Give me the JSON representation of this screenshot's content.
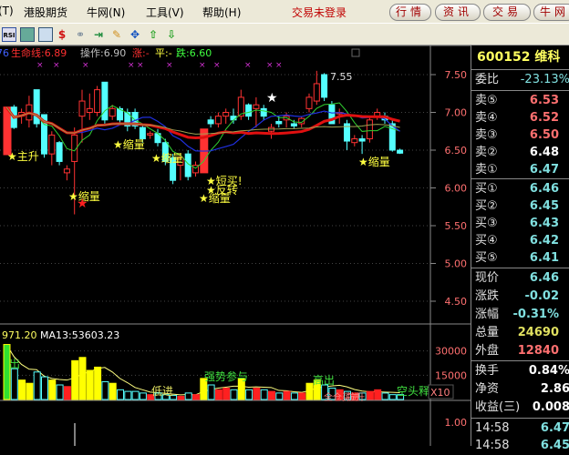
{
  "menu": {
    "items": [
      "(T)",
      "港股期货",
      "牛网(N)",
      "工具(V)",
      "帮助(H)"
    ],
    "login_status": "交易未登录",
    "buttons": [
      "行情",
      "资讯",
      "交易",
      "牛网"
    ]
  },
  "toolbar": {
    "icons": [
      "rsi-icon",
      "refresh-icon",
      "grid-icon",
      "dollar-icon",
      "connect-icon",
      "export-icon",
      "pencil-icon",
      "move-icon",
      "up-arrow-icon",
      "down-arrow-icon"
    ],
    "rsi_label": "RSI"
  },
  "indicator_header": {
    "prefix": "76",
    "life_line": "生命线:6.89",
    "operate": "操作:6.90",
    "rise": "涨:-",
    "flat": "平:-",
    "fall": "跌:6.60"
  },
  "price_axis": [
    "7.50",
    "7.00",
    "6.50",
    "6.00",
    "5.50",
    "5.00",
    "4.50"
  ],
  "annotations": {
    "high_label": "7.55",
    "signals": [
      "主升",
      "缩量",
      "缩量",
      "缩量",
      "短买!",
      "反转",
      "缩量",
      "缩量"
    ]
  },
  "volume_header": {
    "ma1": "971.20",
    "ma13": "MA13:53603.23"
  },
  "volume_axis": [
    "30000",
    "15000"
  ],
  "volume_labels": [
    "出",
    "强势参与",
    "低进",
    "高出",
    "空头释",
    "X10",
    "拉升",
    "全仓买进"
  ],
  "lower_axis": [
    "1.00"
  ],
  "quote": {
    "title": "600152 维科",
    "ratio_label": "委比",
    "ratio": "-23.13%",
    "asks": [
      {
        "label": "卖⑤",
        "price": "6.53"
      },
      {
        "label": "卖④",
        "price": "6.52"
      },
      {
        "label": "卖③",
        "price": "6.50"
      },
      {
        "label": "卖②",
        "price": "6.48"
      },
      {
        "label": "卖①",
        "price": "6.47"
      }
    ],
    "bids": [
      {
        "label": "买①",
        "price": "6.46"
      },
      {
        "label": "买②",
        "price": "6.45"
      },
      {
        "label": "买③",
        "price": "6.43"
      },
      {
        "label": "买④",
        "price": "6.42"
      },
      {
        "label": "买⑤",
        "price": "6.41"
      }
    ],
    "stats": [
      {
        "label": "现价",
        "value": "6.46"
      },
      {
        "label": "涨跌",
        "value": "-0.02"
      },
      {
        "label": "涨幅",
        "value": "-0.31%"
      },
      {
        "label": "总量",
        "value": "24690"
      },
      {
        "label": "外盘",
        "value": "12840"
      }
    ],
    "stats2": [
      {
        "label": "换手",
        "value": "0.84%"
      },
      {
        "label": "净资",
        "value": "2.86"
      },
      {
        "label": "收益(三)",
        "value": "0.008"
      }
    ],
    "ticks": [
      {
        "time": "14:58",
        "price": "6.47"
      },
      {
        "time": "14:58",
        "price": "6.45"
      }
    ]
  },
  "colors": {
    "up": "#ff3232",
    "down": "#54ffff",
    "ma_thick": "#e01010",
    "ma_blue": "#1020d0",
    "signal": "#ffff00"
  },
  "chart_data": {
    "type": "candlestick",
    "ylim": [
      4.4,
      7.7
    ],
    "ohlc": [
      [
        6.44,
        7.07,
        7.07,
        6.44,
        1
      ],
      [
        7.07,
        6.8,
        7.1,
        6.78
      ],
      [
        6.95,
        7.0,
        7.05,
        6.85
      ],
      [
        6.9,
        7.1,
        7.22,
        6.8
      ],
      [
        7.3,
        6.85,
        7.3,
        6.8
      ],
      [
        6.97,
        6.45,
        6.97,
        6.4
      ],
      [
        6.45,
        6.7,
        6.75,
        6.3
      ],
      [
        6.6,
        6.35,
        6.62,
        6.3
      ],
      [
        6.2,
        6.25,
        6.3,
        6.1
      ],
      [
        6.35,
        6.7,
        6.8,
        5.65
      ],
      [
        6.95,
        7.15,
        7.3,
        6.6
      ],
      [
        7.0,
        7.05,
        7.25,
        6.9
      ],
      [
        7.0,
        7.3,
        7.35,
        6.95
      ],
      [
        7.4,
        6.9,
        7.4,
        6.85
      ],
      [
        6.95,
        7.05,
        7.1,
        6.9
      ],
      [
        7.05,
        6.9,
        7.08,
        6.85
      ],
      [
        7.0,
        6.82,
        7.05,
        6.75
      ],
      [
        7.0,
        6.82,
        7.05,
        6.78
      ],
      [
        6.8,
        6.65,
        6.85,
        6.6
      ],
      [
        6.7,
        6.72,
        6.75,
        6.65
      ],
      [
        6.72,
        6.6,
        6.78,
        6.55
      ],
      [
        6.6,
        6.35,
        6.65,
        6.3
      ],
      [
        6.4,
        6.1,
        6.45,
        6.05
      ],
      [
        6.3,
        6.4,
        6.45,
        6.1
      ],
      [
        6.45,
        6.15,
        6.5,
        6.1
      ],
      [
        6.2,
        6.3,
        6.35,
        6.15
      ],
      [
        6.2,
        6.78,
        6.78,
        6.2,
        1
      ],
      [
        6.9,
        6.85,
        6.95,
        6.8
      ],
      [
        6.85,
        6.95,
        7.0,
        6.8
      ],
      [
        6.95,
        7.0,
        7.05,
        6.85
      ],
      [
        6.95,
        6.9,
        7.05,
        6.85
      ],
      [
        6.95,
        7.2,
        7.3,
        6.9
      ],
      [
        7.1,
        6.95,
        7.12,
        6.9
      ],
      [
        7.05,
        7.1,
        7.2,
        6.8
      ],
      [
        7.05,
        6.95,
        7.1,
        6.9
      ],
      [
        6.75,
        6.8,
        6.85,
        6.65
      ],
      [
        6.88,
        6.85,
        6.95,
        6.8
      ],
      [
        6.9,
        6.95,
        7.0,
        6.8
      ],
      [
        6.85,
        6.82,
        6.9,
        6.78
      ],
      [
        6.85,
        6.92,
        6.95,
        6.8
      ],
      [
        7.05,
        7.2,
        7.25,
        7.0
      ],
      [
        7.15,
        7.38,
        7.55,
        7.1
      ],
      [
        7.5,
        7.2,
        7.52,
        7.15
      ],
      [
        7.1,
        6.85,
        7.15,
        6.85
      ],
      [
        6.98,
        7.0,
        7.05,
        6.85
      ],
      [
        6.85,
        6.62,
        6.9,
        6.5
      ],
      [
        6.6,
        6.65,
        6.7,
        6.55
      ],
      [
        6.65,
        6.62,
        6.7,
        6.45
      ],
      [
        6.65,
        6.9,
        6.95,
        6.6
      ],
      [
        6.95,
        7.0,
        7.05,
        6.9
      ],
      [
        6.95,
        6.9,
        7.0,
        6.85
      ],
      [
        6.85,
        6.5,
        6.9,
        6.48
      ],
      [
        6.5,
        6.46,
        6.52,
        6.45
      ]
    ],
    "volume": [
      34000,
      19000,
      12000,
      10000,
      17000,
      14000,
      12000,
      9000,
      8000,
      24000,
      26000,
      18000,
      20000,
      11000,
      10000,
      6000,
      5000,
      5000,
      4000,
      3000,
      4000,
      3000,
      2500,
      2000,
      4000,
      3000,
      13000,
      9000,
      6000,
      7000,
      6000,
      13000,
      6000,
      7000,
      6000,
      5000,
      4000,
      5000,
      4000,
      4000,
      10000,
      12000,
      9000,
      7000,
      6000,
      5000,
      4000,
      4000,
      5000,
      6000,
      4000,
      3000,
      3000
    ],
    "volume_ylim": [
      0,
      36000
    ]
  }
}
